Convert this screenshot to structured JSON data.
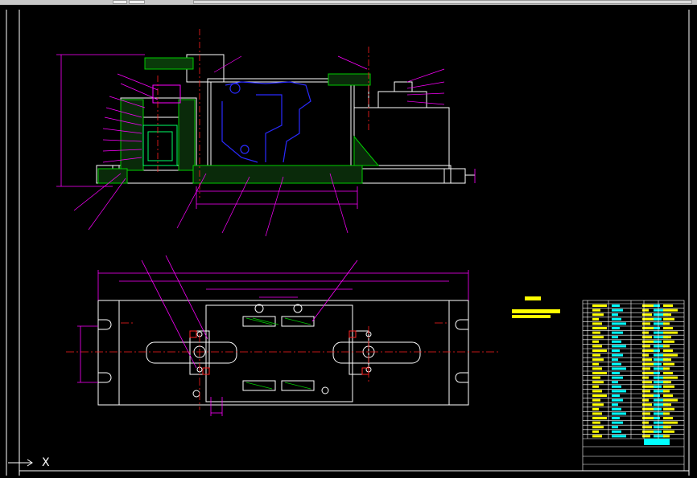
{
  "window": {
    "tabs": [
      "",
      "",
      ""
    ]
  },
  "colors": {
    "background": "#000000",
    "outline": "#ffffff",
    "centerline": "#ff2020",
    "dimension": "#ff00ff",
    "hatch": "#00cc00",
    "hidden": "#2a2aff",
    "text": "#ffff00",
    "table_fill": "#00ffff"
  },
  "drawing": {
    "axis_label": "X",
    "technical_requirements_title": "技术要求"
  }
}
